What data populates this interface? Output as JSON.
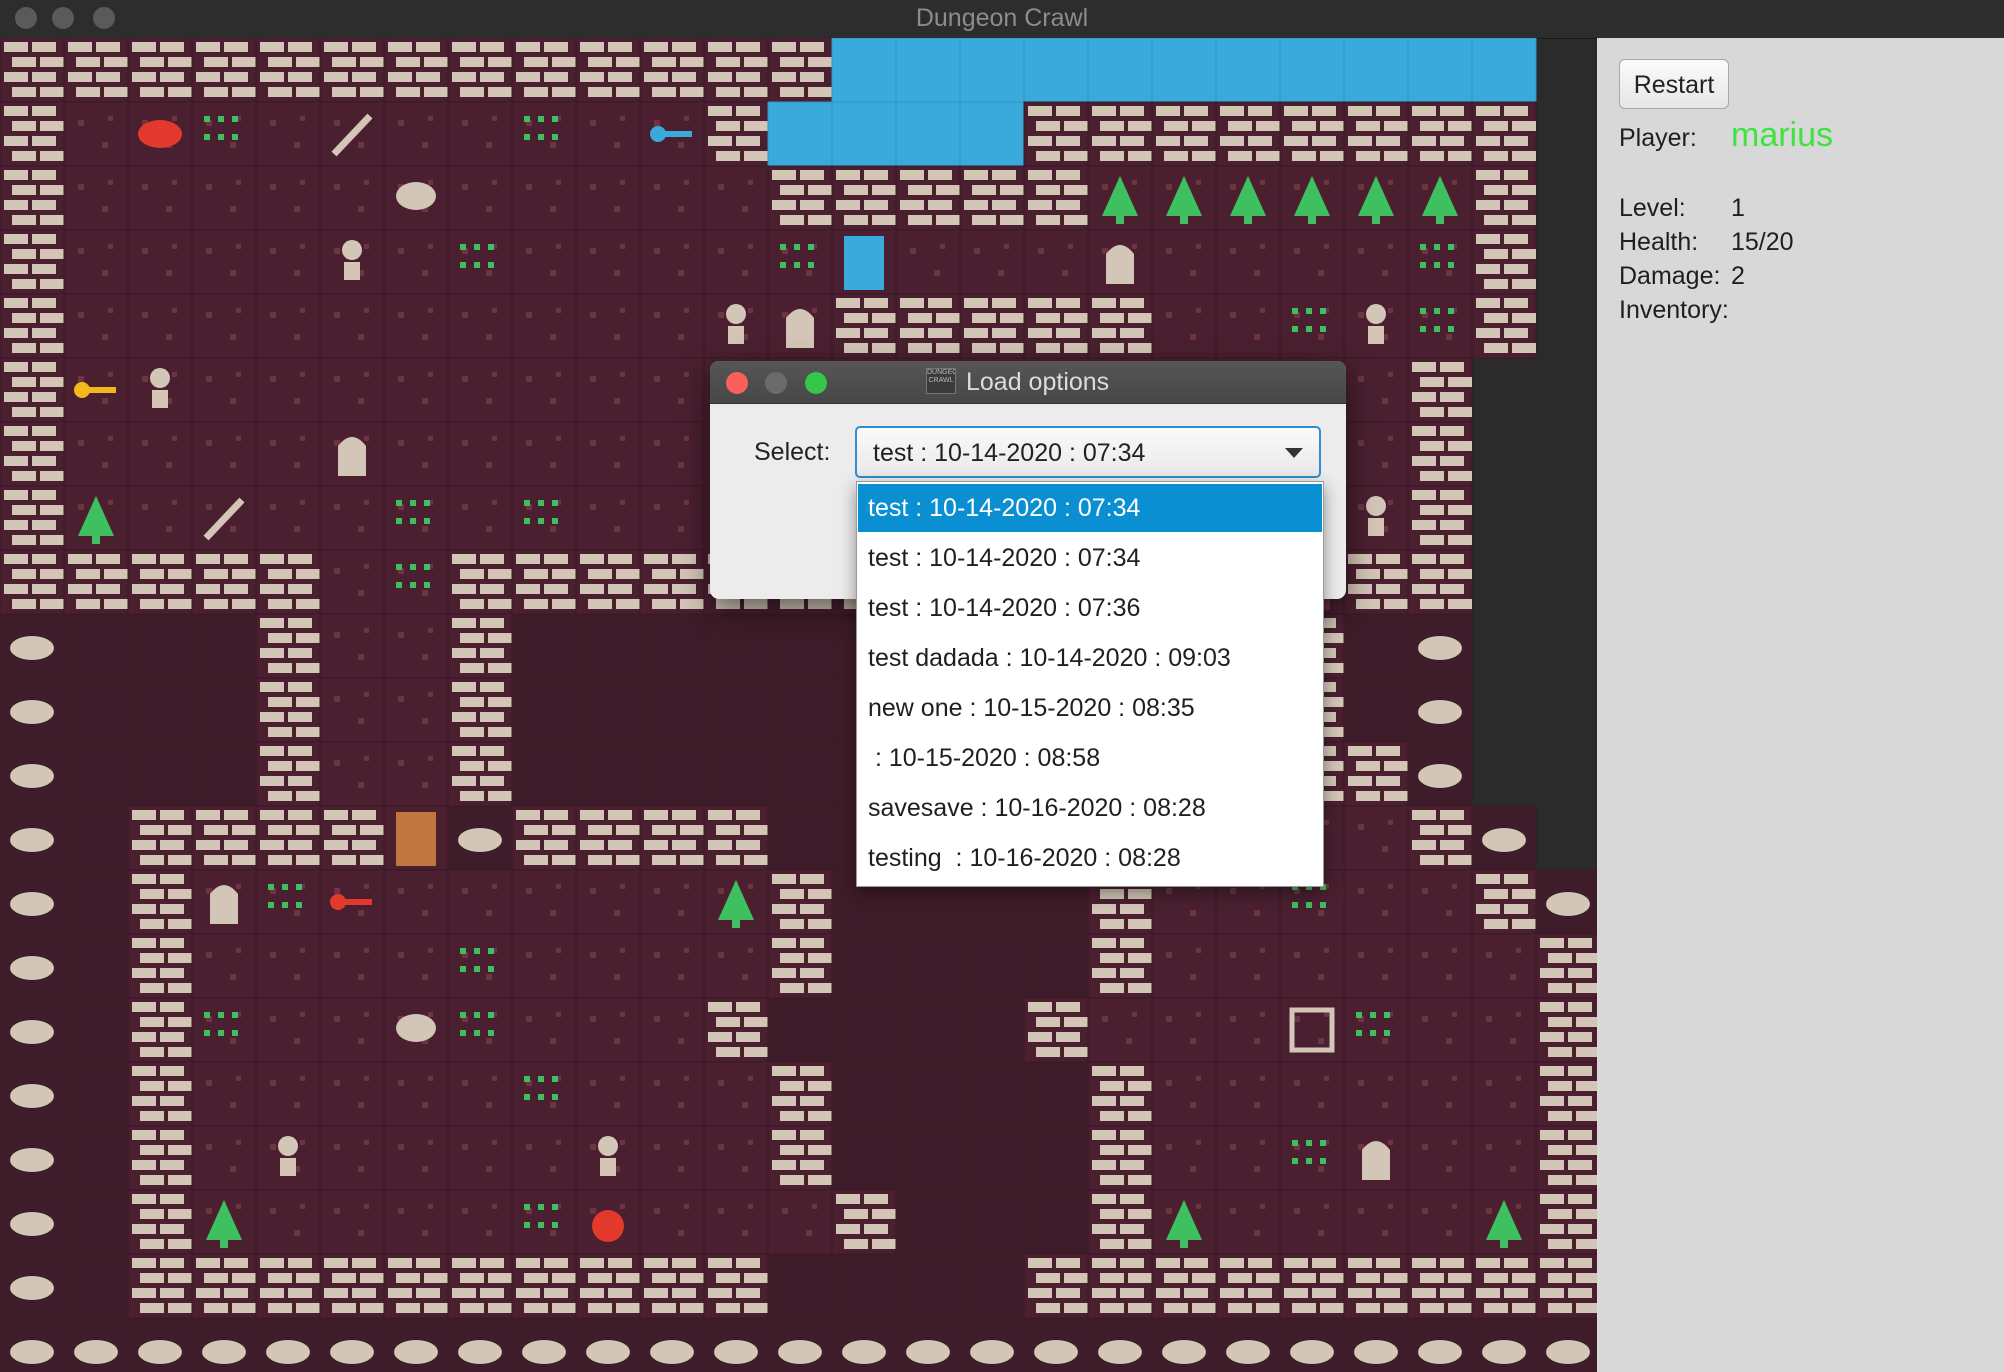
{
  "window": {
    "title": "Dungeon Crawl"
  },
  "panel": {
    "restart_label": "Restart",
    "player_label": "Player:",
    "player_name": "marius",
    "level_label": "Level:",
    "level_value": "1",
    "health_label": "Health:",
    "health_value": "15/20",
    "damage_label": "Damage:",
    "damage_value": "2",
    "inventory_label": "Inventory:"
  },
  "dialog": {
    "title": "Load options",
    "logo_text": "DUNGEON CRAWL",
    "select_label": "Select:",
    "selected_value": "test : 10-14-2020 : 07:34",
    "options": [
      "test : 10-14-2020 : 07:34",
      "test : 10-14-2020 : 07:34",
      "test : 10-14-2020 : 07:36",
      "test dadada : 10-14-2020 : 09:03",
      "new one : 10-15-2020 : 08:35",
      " : 10-15-2020 : 08:58",
      "savesave : 10-16-2020 : 08:28",
      "testing  : 10-16-2020 : 08:28"
    ],
    "highlighted_index": 0
  },
  "colors": {
    "floor": "#4a2030",
    "water": "#3aa9dc",
    "wall": "#d3c6b7",
    "plant": "#3fbf5f",
    "player_name": "#3fe33f",
    "highlight": "#0a8fd2"
  },
  "map": {
    "legend": {
      "W": "brick-wall",
      "f": "floor",
      "d": "dark-floor",
      "~": "water",
      "r": "rock",
      "T": "tree",
      "g": "grass",
      "s": "skeleton",
      "G": "ghost",
      "S": "spider",
      "k": "blue-key",
      "y": "yellow-key",
      "R": "red-key",
      "x": "sword",
      "m": "meat",
      "a": "apple",
      "D": "door",
      "B": "blue-door",
      "O": "orange-door",
      "P": "portal",
      "K": "knight",
      "c": "crate"
    },
    "rows": [
      "WWWWWWWWWWWWW~~~~~~~~~~~",
      "WfmgfxffgfkW~~~~WWWWWWWW",
      "WfffffSfffffWWWWWTTTTTTW",
      "WffffsfgffffgBfffGffffgW",
      "WffffffffffsGWWWWWffgsgW",
      "WysfffffffffffffffffffW",
      "WffffGffffffffffffffgfW",
      "WTfxffgfgffffffffffffsW",
      "WWWWWfgWWWWWWWWWWWWWDWW",
      "rdddWffWdddddddddd~PWdr",
      "rdddWffWdddddddddd~DWdr",
      "rdddWffWdddddddddd~DWWr",
      "rdWWWWOrWWWWdddddddfffWr",
      "rdWGgRfffffTWddddWffgffWr",
      "rdWffffgffffWddddWffffffWr",
      "rdWgffSgfffWddddWfffcgffWr",
      "rdWfffffgfffWddddWffffffWr",
      "rdWfKffffsffWddddWffgGffWr",
      "rdWTffffgafffWdddWTffffTWr",
      "rdWWWWWWWWWWddddWWWWWWWWWr",
      "rrrrrrrrrrrrrrrrrrrrrrrrrr"
    ]
  }
}
